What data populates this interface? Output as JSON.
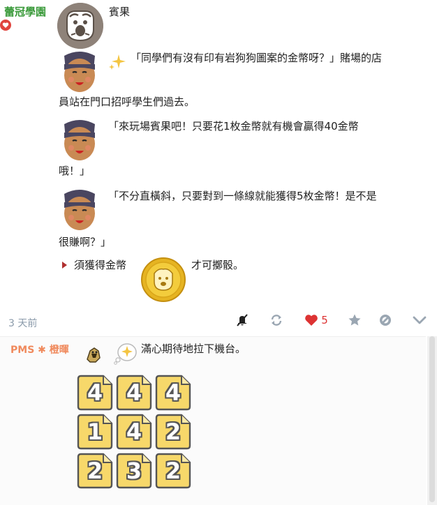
{
  "post": {
    "author": "蕾冠學園",
    "title": "賓果",
    "line1": "「同學們有沒有印有岩狗狗圖案的金幣呀？」賭場的店",
    "line2": "員站在門口招呼學生們過去。",
    "line3": "「來玩場賓果吧！只要花1枚金幣就有機會贏得40金幣",
    "line4": "哦！」",
    "line5": "「不分直橫斜，只要對到一條線就能獲得5枚金幣！是不是",
    "line6": "很賺啊？」",
    "req_prefix": "須獲得金幣",
    "req_suffix": "才可擲骰。",
    "timestamp": "3 天前",
    "likes": "5"
  },
  "comment": {
    "user": "PMS",
    "user_star": "✱",
    "user_name": "橙暉",
    "text": "滿心期待地拉下機台。",
    "dice": [
      "4",
      "4",
      "4",
      "1",
      "4",
      "2",
      "2",
      "3",
      "2"
    ]
  },
  "icons": {
    "mute": "mute-icon",
    "repost": "repost-icon",
    "heart": "heart-icon",
    "star": "star-icon",
    "block": "block-icon",
    "chevron": "chevron-down-icon"
  },
  "colors": {
    "author": "#3a9a3a",
    "comment_user": "#f08a5d",
    "like": "#dd3333",
    "timestamp": "#8a9aaa"
  }
}
